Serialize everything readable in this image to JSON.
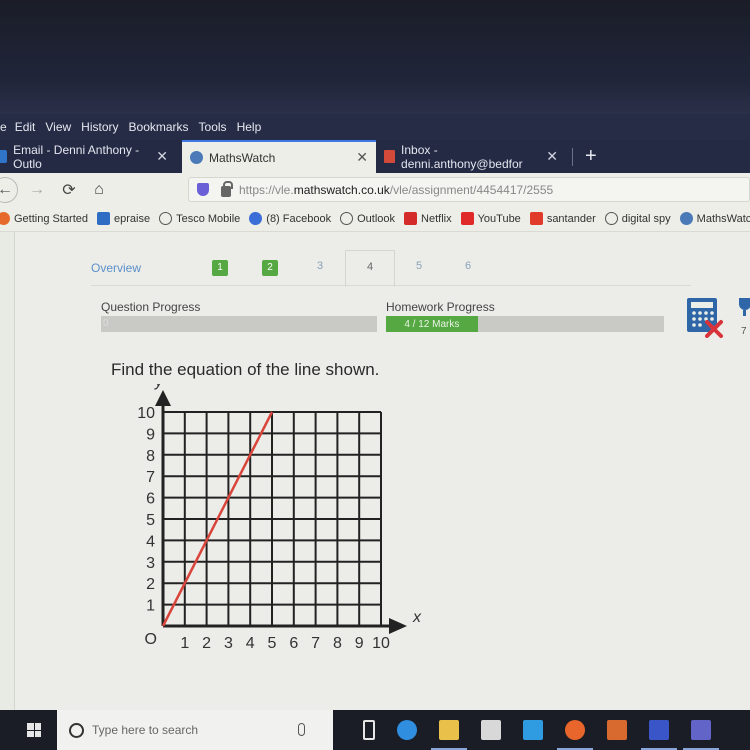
{
  "browser": {
    "menu": [
      {
        "label": "e",
        "underline": ""
      },
      {
        "label": "Edit"
      },
      {
        "label": "View"
      },
      {
        "label": "History"
      },
      {
        "label": "Bookmarks"
      },
      {
        "label": "Tools"
      },
      {
        "label": "Help"
      }
    ],
    "tabs": [
      {
        "title": "Email - Denni Anthony - Outlo",
        "active": false
      },
      {
        "title": "MathsWatch",
        "active": true
      },
      {
        "title": "Inbox - denni.anthony@bedfor",
        "active": false
      }
    ],
    "close_glyph": "✕",
    "new_tab_glyph": "+",
    "url": {
      "scheme": "https://vle.",
      "domain": "mathswatch.co.uk",
      "path": "/vle/assignment/4454417/2555"
    },
    "nav": {
      "back": "←",
      "forward": "→",
      "reload": "⟳",
      "home": "⌂"
    },
    "bookmarks": [
      {
        "label": "Getting Started",
        "icon": "firefox-icon",
        "color": "#e66a2b"
      },
      {
        "label": "epraise",
        "icon": "epraise-icon",
        "color": "#2f6cc4"
      },
      {
        "label": "Tesco Mobile",
        "icon": "globe-icon",
        "color": "#555555"
      },
      {
        "label": "(8) Facebook",
        "icon": "facebook-icon",
        "color": "#3b6ed6"
      },
      {
        "label": "Outlook",
        "icon": "globe-icon",
        "color": "#555555"
      },
      {
        "label": "Netflix",
        "icon": "netflix-icon",
        "color": "#d42a2a"
      },
      {
        "label": "YouTube",
        "icon": "youtube-icon",
        "color": "#e02a2a"
      },
      {
        "label": "santander",
        "icon": "santander-icon",
        "color": "#e03a2a"
      },
      {
        "label": "digital spy",
        "icon": "globe-icon",
        "color": "#555555"
      },
      {
        "label": "MathsWatch",
        "icon": "mathswatch-icon",
        "color": "#4a7ab8"
      }
    ]
  },
  "app": {
    "overview_label": "Overview",
    "questions": [
      {
        "label": "1",
        "status": "done"
      },
      {
        "label": "2",
        "status": "done"
      },
      {
        "label": "3",
        "status": "todo"
      },
      {
        "label": "4",
        "status": "current"
      },
      {
        "label": "5",
        "status": "todo"
      },
      {
        "label": "6",
        "status": "todo"
      }
    ],
    "question_progress": {
      "label": "Question Progress",
      "value_text": "0",
      "fraction": 0
    },
    "homework_progress": {
      "label": "Homework Progress",
      "value_text": "4 / 12 Marks",
      "fraction": 0.3333
    },
    "side_number": "7",
    "question_text": "Find the equation of the line shown.",
    "colors": {
      "green": "#56a843",
      "line": "#d9443b",
      "calc_blue": "#2f66a8",
      "cross_red": "#d8333a"
    }
  },
  "chart_data": {
    "type": "line",
    "title": "",
    "xlabel": "x",
    "ylabel": "y",
    "origin_label": "O",
    "xlim": [
      0,
      10
    ],
    "ylim": [
      0,
      10
    ],
    "grid": true,
    "x_ticks": [
      "1",
      "2",
      "3",
      "4",
      "5",
      "6",
      "7",
      "8",
      "9",
      "10"
    ],
    "y_ticks": [
      "1",
      "2",
      "3",
      "4",
      "5",
      "6",
      "7",
      "8",
      "9",
      "10"
    ],
    "series": [
      {
        "name": "line",
        "x": [
          0,
          5
        ],
        "y": [
          0,
          10
        ],
        "color": "#d9443b"
      }
    ]
  },
  "taskbar": {
    "search_placeholder": "Type here to search",
    "apps": [
      {
        "name": "task-view-icon",
        "color": "#e6e6e6"
      },
      {
        "name": "edge-icon",
        "color": "#2f8ee0"
      },
      {
        "name": "file-explorer-icon",
        "color": "#e8c04a"
      },
      {
        "name": "store-icon",
        "color": "#d8d8d8"
      },
      {
        "name": "mail-icon",
        "color": "#2f9be0"
      },
      {
        "name": "firefox-icon",
        "color": "#e8662b"
      },
      {
        "name": "powerpoint-icon",
        "color": "#d86a2f"
      },
      {
        "name": "word-icon",
        "color": "#3a55c8"
      },
      {
        "name": "teams-icon",
        "color": "#6264c8"
      }
    ]
  }
}
